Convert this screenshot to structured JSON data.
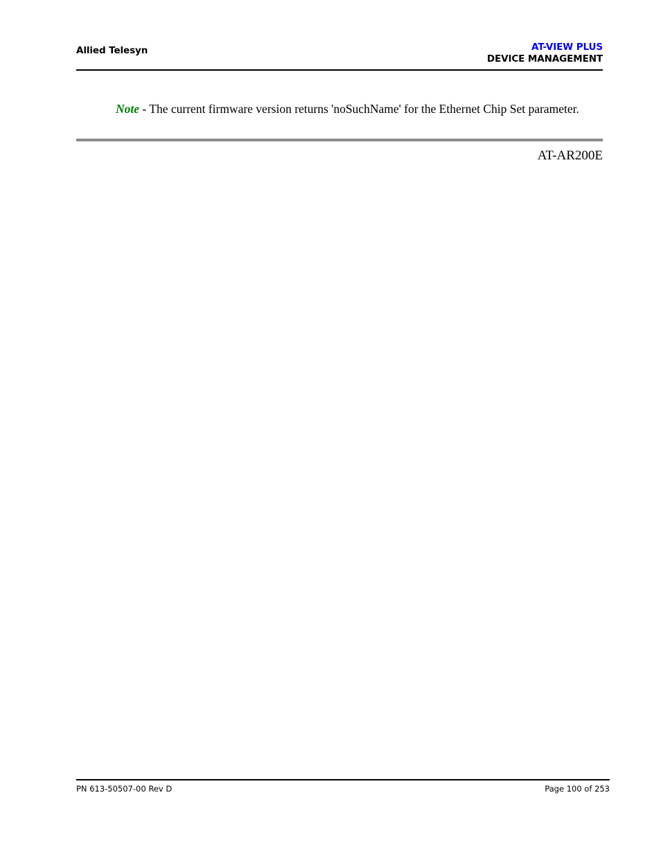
{
  "header": {
    "company": "Allied Telesyn",
    "product": "AT-VIEW PLUS",
    "section": "DEVICE MANAGEMENT",
    "product_color": "#0000ff",
    "section_color": "#000000"
  },
  "body": {
    "note": {
      "label": "Note",
      "label_color": "#008000",
      "text": " - The current firmware version returns 'noSuchName' for the Ethernet Chip Set parameter."
    },
    "device_name": "AT-AR200E",
    "separator_color": "#8c8c8c"
  },
  "footer": {
    "part_number": "PN 613-50507-00 Rev D",
    "page_number": "Page 100 of 253"
  }
}
